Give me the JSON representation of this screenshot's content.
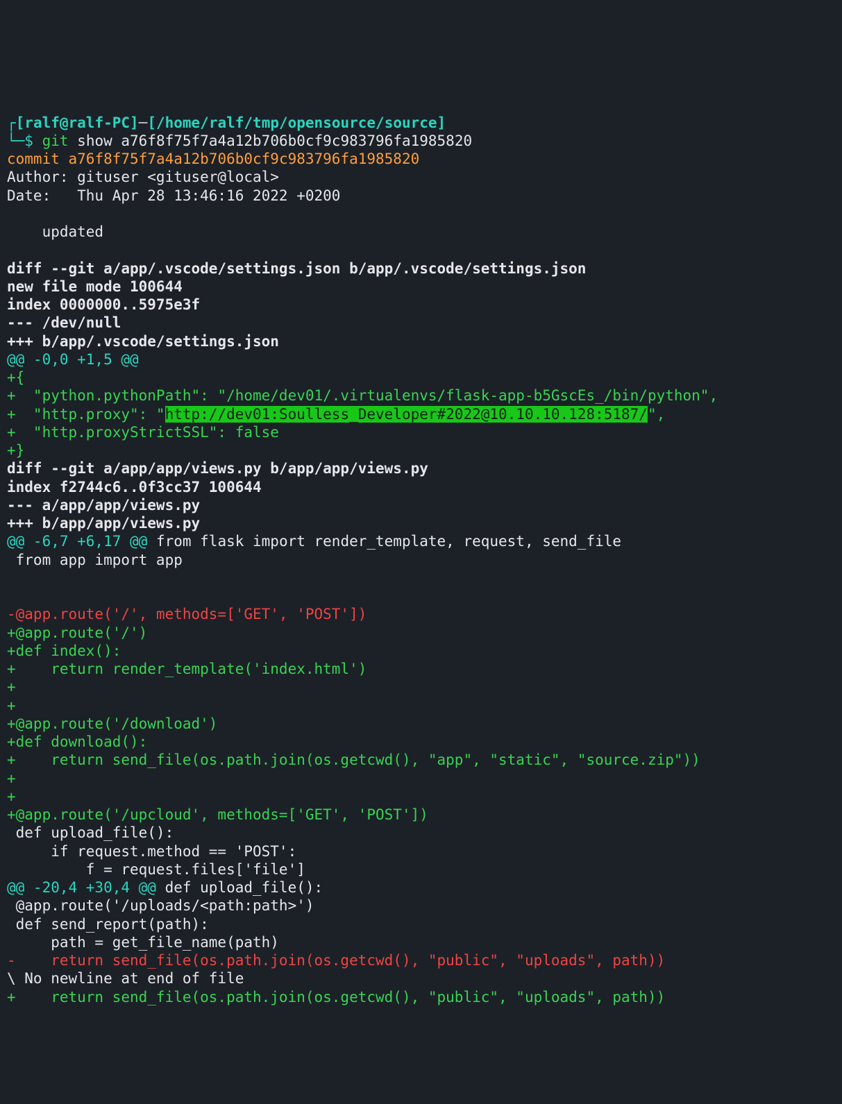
{
  "prompt": {
    "user_host": "[ralf@ralf-PC]",
    "sep1": "─",
    "cwd": "[/home/ralf/tmp/opensource/source]",
    "corner_top": "┌",
    "corner_bottom": "└─",
    "dollar": "$ ",
    "cmd_bin": "git",
    "cmd_args": " show a76f8f75f7a4a12b706b0cf9c983796fa1985820"
  },
  "commit": {
    "label": "commit ",
    "hash": "a76f8f75f7a4a12b706b0cf9c983796fa1985820",
    "author": "Author: gituser <gituser@local>",
    "date": "Date:   Thu Apr 28 13:46:16 2022 +0200",
    "blank": "",
    "message": "    updated"
  },
  "diff": {
    "file1_header": "diff --git a/app/.vscode/settings.json b/app/.vscode/settings.json",
    "file1_newmode": "new file mode 100644",
    "file1_index": "index 0000000..5975e3f",
    "file1_minus": "--- /dev/null",
    "file1_plus": "+++ b/app/.vscode/settings.json",
    "file1_hunk": "@@ -0,0 +1,5 @@",
    "s_open": "+{",
    "s_pythonpath": "+  \"python.pythonPath\": \"/home/dev01/.virtualenvs/flask-app-b5GscEs_/bin/python\",",
    "s_proxy_pre": "+  \"http.proxy\": \"",
    "s_proxy_hl": "http://dev01:Soulless_Developer#2022@10.10.10.128:5187/",
    "s_proxy_post": "\",",
    "s_strict": "+  \"http.proxyStrictSSL\": false",
    "s_close": "+}",
    "file2_header": "diff --git a/app/app/views.py b/app/app/views.py",
    "file2_index": "index f2744c6..0f3cc37 100644",
    "file2_minus": "--- a/app/app/views.py",
    "file2_plus": "+++ b/app/app/views.py",
    "file2_hunk1a": "@@ -6,7 +6,17 @@",
    "file2_hunk1b": " from flask import render_template, request, send_file",
    "ctx_import": " from app import app",
    "rem_route": "-@app.route('/', methods=['GET', 'POST'])",
    "add_route_root": "+@app.route('/')",
    "add_def_index": "+def index():",
    "add_return_index": "+    return render_template('index.html')",
    "add_blank1": "+",
    "add_blank2": "+",
    "add_route_download": "+@app.route('/download')",
    "add_def_download": "+def download():",
    "add_return_download": "+    return send_file(os.path.join(os.getcwd(), \"app\", \"static\", \"source.zip\"))",
    "add_blank3": "+",
    "add_blank4": "+",
    "add_route_upcloud": "+@app.route('/upcloud', methods=['GET', 'POST'])",
    "ctx_def_upload": " def upload_file():",
    "ctx_if_post": "     if request.method == 'POST':",
    "ctx_assign_f": "         f = request.files['file']",
    "file2_hunk2a": "@@ -20,4 +30,4 @@",
    "file2_hunk2b": " def upload_file():",
    "ctx_route_uploads": " @app.route('/uploads/<path:path>')",
    "ctx_def_send": " def send_report(path):",
    "ctx_path_assign": "     path = get_file_name(path)",
    "rem_return": "-    return send_file(os.path.join(os.getcwd(), \"public\", \"uploads\", path))",
    "ctx_nonewline": "\\ No newline at end of file",
    "add_return": "+    return send_file(os.path.join(os.getcwd(), \"public\", \"uploads\", path))"
  }
}
